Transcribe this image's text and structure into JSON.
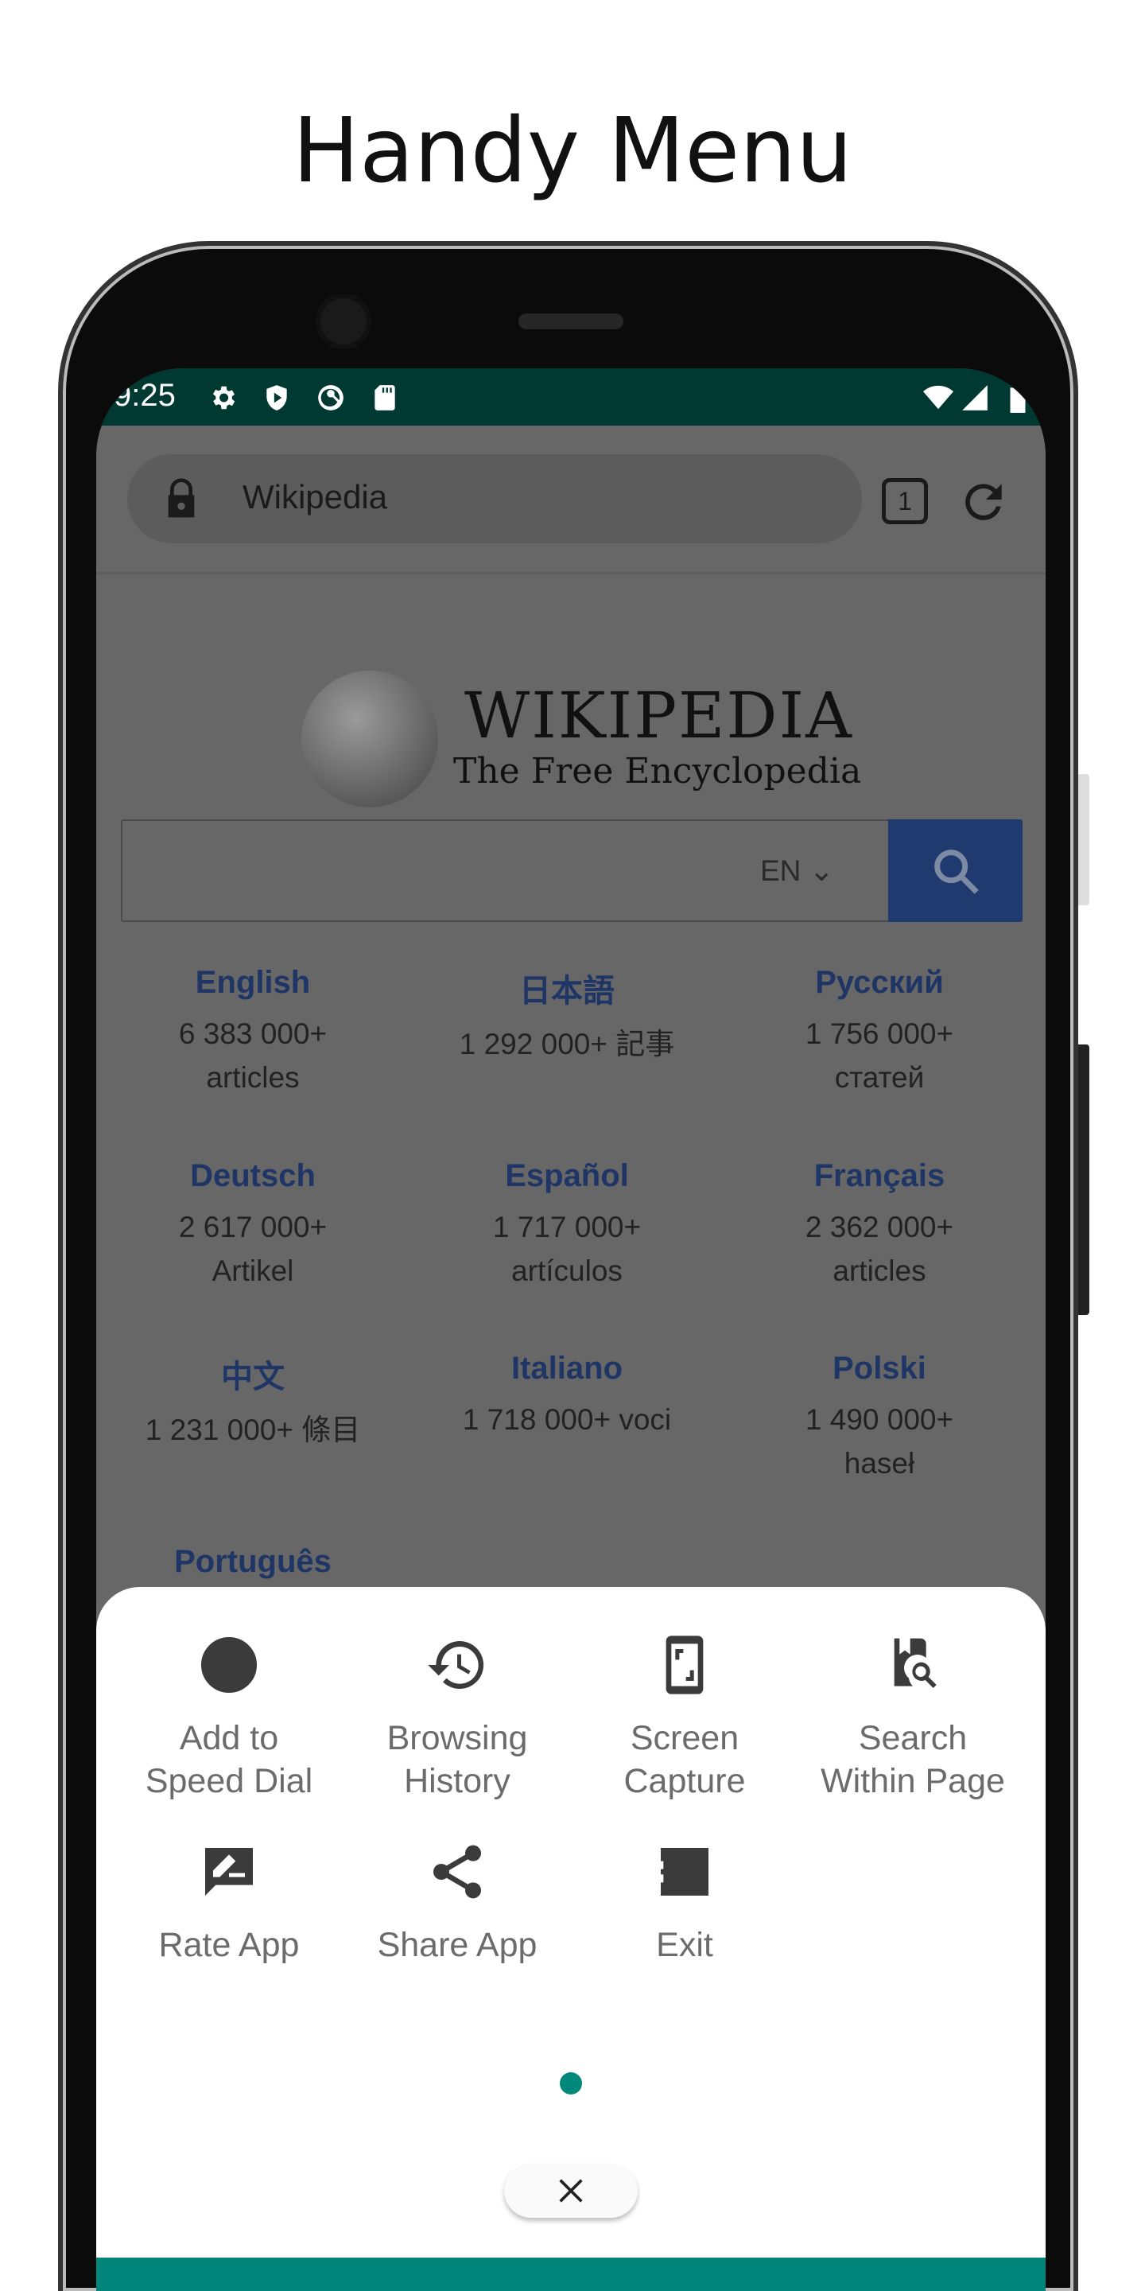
{
  "title": "Handy Menu",
  "status_bar": {
    "time": "9:25",
    "icons": [
      "settings-icon",
      "shield-play-icon",
      "at-sign-icon",
      "sd-card-icon",
      "wifi-icon",
      "signal-icon",
      "battery-icon"
    ],
    "color": "#003832"
  },
  "browser": {
    "url_text": "Wikipedia",
    "tab_count": "1",
    "icons": [
      "lock-icon",
      "tabs-icon",
      "reload-icon"
    ]
  },
  "wikipedia": {
    "wordmark": "WIKIPEDIA",
    "tagline": "The Free Encyclopedia",
    "language_select": "EN",
    "languages": [
      {
        "name": "English",
        "count": "6 383 000+",
        "unit": "articles"
      },
      {
        "name": "日本語",
        "count": "1 292 000+ 記事",
        "unit": ""
      },
      {
        "name": "Русский",
        "count": "1 756 000+",
        "unit": "статей"
      },
      {
        "name": "Deutsch",
        "count": "2 617 000+",
        "unit": "Artikel"
      },
      {
        "name": "Español",
        "count": "1 717 000+",
        "unit": "artículos"
      },
      {
        "name": "Français",
        "count": "2 362 000+",
        "unit": "articles"
      },
      {
        "name": "中文",
        "count": "1 231 000+ 條目",
        "unit": ""
      },
      {
        "name": "Italiano",
        "count": "1 718 000+ voci",
        "unit": ""
      },
      {
        "name": "Polski",
        "count": "1 490 000+",
        "unit": "haseł"
      },
      {
        "name": "Português",
        "count": "",
        "unit": ""
      }
    ]
  },
  "menu": {
    "items": [
      {
        "label": "Add to\nSpeed Dial",
        "icon": "add-circle-icon"
      },
      {
        "label": "Browsing\nHistory",
        "icon": "history-icon"
      },
      {
        "label": "Screen\nCapture",
        "icon": "screen-capture-icon"
      },
      {
        "label": "Search\nWithin Page",
        "icon": "find-in-page-icon"
      },
      {
        "label": "Rate App",
        "icon": "rate-review-icon"
      },
      {
        "label": "Share App",
        "icon": "share-icon"
      },
      {
        "label": "Exit",
        "icon": "exit-icon"
      }
    ],
    "page_indicator": {
      "pages": 1,
      "current": 1
    },
    "close_icon": "close-icon",
    "accent": "#00897b"
  }
}
